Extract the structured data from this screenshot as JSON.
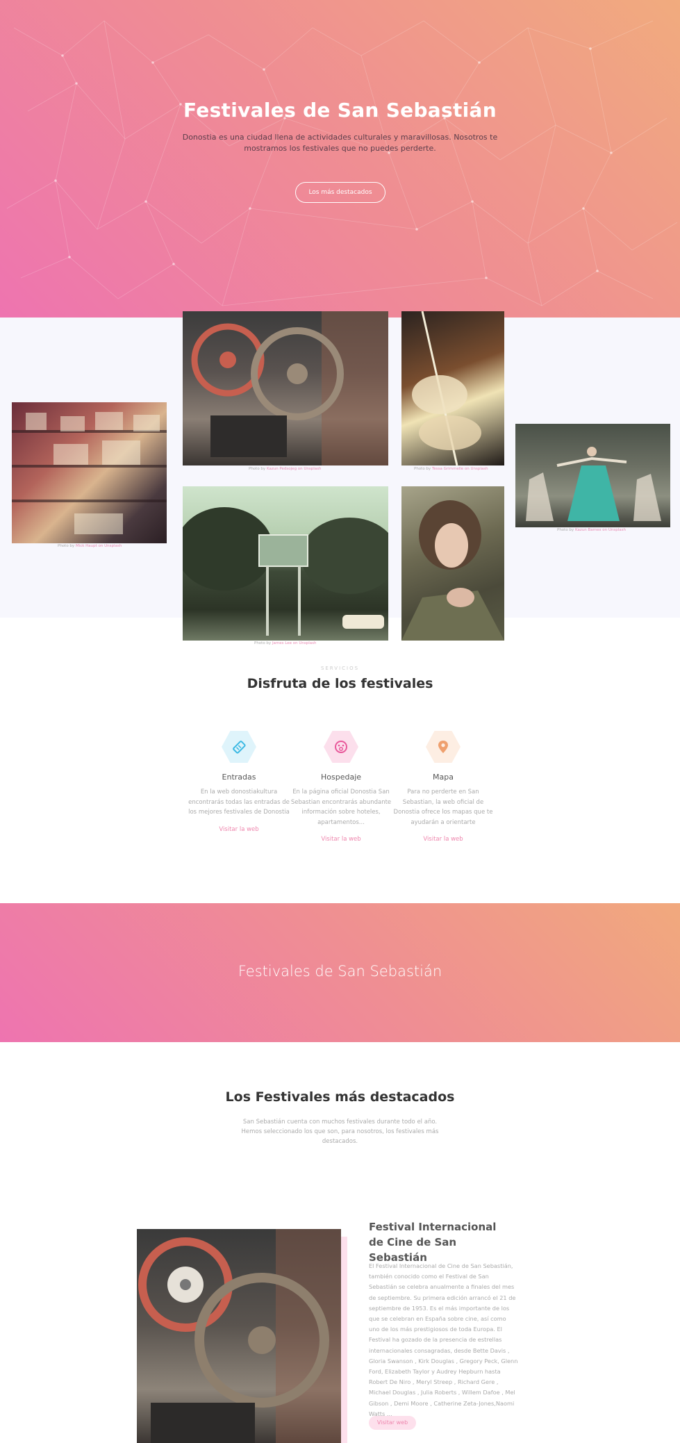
{
  "hero": {
    "title": "Festivales de San Sebastián",
    "subtitle": "Donostia es una ciudad llena de actividades culturales y maravillosas. Nosotros te mostramos los festivales que no puedes perderte.",
    "button_label": "Los más destacados"
  },
  "gallery": {
    "captions": [
      {
        "prefix": "Photo by ",
        "author": "Mick Haupt on Unsplash"
      },
      {
        "prefix": "Photo by ",
        "author": "Kazun Pedsojeg on Unsplash"
      },
      {
        "prefix": "Photo by ",
        "author": "Tessa Grimmelle on Unsplash"
      },
      {
        "prefix": "Photo by ",
        "author": "Kazun Barnes on Unsplash"
      },
      {
        "prefix": "Photo by ",
        "author": "James Lee on Unsplash"
      }
    ]
  },
  "services": {
    "kicker": "SERVICIOS",
    "title": "Disfruta de los festivales",
    "items": [
      {
        "icon": "ticket-icon",
        "name": "Entradas",
        "description": "En la web donostiakultura encontrarás todas las entradas de los mejores festivales de Donostia",
        "link": "Visitar la web",
        "color": "#3cb9e3",
        "bg": "#dff4fb"
      },
      {
        "icon": "hotel-icon",
        "name": "Hospedaje",
        "description": "En la página oficial Donostia San Sebastian encontrarás abundante información sobre hoteles, apartamentos...",
        "link": "Visitar la web",
        "color": "#e8589a",
        "bg": "#fcdfec"
      },
      {
        "icon": "map-pin-icon",
        "name": "Mapa",
        "description": "Para no perderte en San Sebastian, la web oficial de Donostia ofrece los mapas que te ayudarán a orientarte",
        "link": "Visitar la web",
        "color": "#efa06e",
        "bg": "#fdeee3"
      }
    ]
  },
  "band": {
    "title": "Festivales de San Sebastián"
  },
  "destacados": {
    "title": "Los Festivales más destacados",
    "subtitle": "San Sebastián cuenta con muchos festivales durante todo el año. Hemos seleccionado los que son, para nosotros, los festivales más destacados."
  },
  "featured": {
    "title": "Festival Internacional de Cine de San Sebastián",
    "description": "El Festival Internacional de Cine de San Sebastián, también conocido como el Festival de San Sebastián se celebra anualmente a finales del mes de septiembre. Su primera edición arrancó el 21 de septiembre de 1953. Es el más importante de los que se celebran en España sobre cine, así como uno de los más prestigiosos de toda Europa. El Festival ha gozado de la presencia de estrellas internacionales consagradas, desde Bette Davis , Gloria Swanson , Kirk Douglas , Gregory Peck, Glenn Ford, Elizabeth Taylor y Audrey Hepburn hasta Robert De Niro , Meryl Streep , Richard Gere , Michael Douglas , Julia Roberts , Willem Dafoe , Mel Gibson , Demi Moore , Catherine Zeta-Jones,Naomi Watts ...",
    "button_label": "Visitar web"
  },
  "colors": {
    "gradient_start": "#ee74b0",
    "gradient_end": "#f1ab7e",
    "accent_pink": "#ee86ad"
  }
}
